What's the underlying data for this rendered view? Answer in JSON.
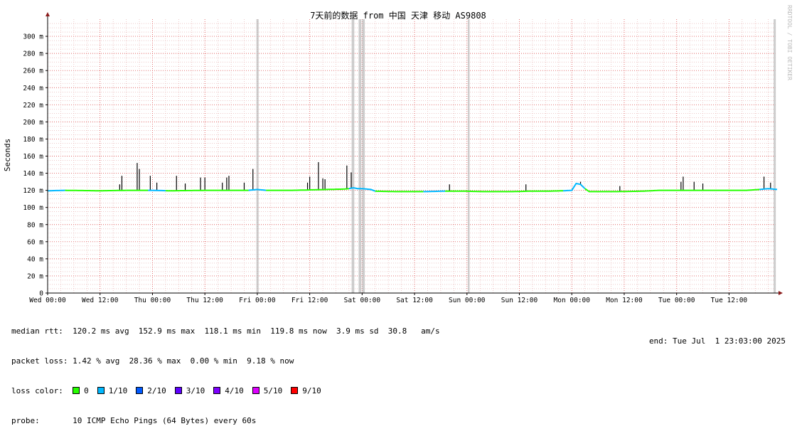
{
  "chart_data": {
    "type": "line",
    "title": "7天前的数据 from 中国 天津 移动 AS9808",
    "ylabel": "Seconds",
    "side_label": "RRDTOOL / TOBI OETIKER",
    "ylim": [
      0,
      320
    ],
    "y_ticks": [
      0,
      20,
      40,
      60,
      80,
      100,
      120,
      140,
      160,
      180,
      200,
      220,
      240,
      260,
      280,
      300
    ],
    "y_tick_labels": [
      "0",
      "20 m",
      "40 m",
      "60 m",
      "80 m",
      "100 m",
      "120 m",
      "140 m",
      "160 m",
      "180 m",
      "200 m",
      "220 m",
      "240 m",
      "260 m",
      "280 m",
      "300 m"
    ],
    "x_range_hours": [
      0,
      167
    ],
    "x_ticks": [
      {
        "label": "Wed 00:00",
        "hours": 0
      },
      {
        "label": "Wed 12:00",
        "hours": 12
      },
      {
        "label": "Thu 00:00",
        "hours": 24
      },
      {
        "label": "Thu 12:00",
        "hours": 36
      },
      {
        "label": "Fri 00:00",
        "hours": 48
      },
      {
        "label": "Fri 12:00",
        "hours": 60
      },
      {
        "label": "Sat 00:00",
        "hours": 72
      },
      {
        "label": "Sat 12:00",
        "hours": 84
      },
      {
        "label": "Sun 00:00",
        "hours": 96
      },
      {
        "label": "Sun 12:00",
        "hours": 108
      },
      {
        "label": "Mon 00:00",
        "hours": 120
      },
      {
        "label": "Mon 12:00",
        "hours": 132
      },
      {
        "label": "Tue 00:00",
        "hours": 144
      },
      {
        "label": "Tue 12:00",
        "hours": 156
      }
    ],
    "series": [
      {
        "name": "median rtt",
        "loss_segments": [
          {
            "x": [
              0,
              4
            ],
            "loss": 1
          },
          {
            "x": [
              4,
              18
            ],
            "loss": 0
          },
          {
            "x": [
              18,
              23
            ],
            "loss": 0
          },
          {
            "x": [
              23,
              27
            ],
            "loss": 1
          },
          {
            "x": [
              27,
              46
            ],
            "loss": 0
          },
          {
            "x": [
              46,
              50
            ],
            "loss": 1
          },
          {
            "x": [
              50,
              69
            ],
            "loss": 0
          },
          {
            "x": [
              69,
              75
            ],
            "loss": 1
          },
          {
            "x": [
              75,
              86
            ],
            "loss": 0
          },
          {
            "x": [
              86,
              91
            ],
            "loss": 1
          },
          {
            "x": [
              91,
              101
            ],
            "loss": 0
          },
          {
            "x": [
              101,
              118
            ],
            "loss": 0
          },
          {
            "x": [
              118,
              123
            ],
            "loss": 1
          },
          {
            "x": [
              123,
              163
            ],
            "loss": 0
          },
          {
            "x": [
              163,
              167
            ],
            "loss": 1
          }
        ],
        "points": [
          [
            0,
            119.5
          ],
          [
            4,
            120
          ],
          [
            12,
            119.5
          ],
          [
            18,
            120
          ],
          [
            22,
            120
          ],
          [
            24,
            120
          ],
          [
            28,
            119.5
          ],
          [
            36,
            120
          ],
          [
            46,
            120
          ],
          [
            48,
            121
          ],
          [
            50,
            120
          ],
          [
            56,
            120
          ],
          [
            60,
            120.5
          ],
          [
            64,
            121
          ],
          [
            68,
            121.5
          ],
          [
            69,
            122
          ],
          [
            70,
            123
          ],
          [
            71,
            122
          ],
          [
            72,
            122
          ],
          [
            74,
            121
          ],
          [
            75,
            119
          ],
          [
            80,
            118.5
          ],
          [
            86,
            118.5
          ],
          [
            90,
            119
          ],
          [
            96,
            119
          ],
          [
            100,
            118.5
          ],
          [
            106,
            118.5
          ],
          [
            110,
            119
          ],
          [
            114,
            119
          ],
          [
            118,
            119.5
          ],
          [
            120,
            120
          ],
          [
            121,
            128
          ],
          [
            122,
            127
          ],
          [
            123,
            122
          ],
          [
            124,
            118.5
          ],
          [
            130,
            118.5
          ],
          [
            136,
            119
          ],
          [
            140,
            120
          ],
          [
            146,
            120
          ],
          [
            152,
            120
          ],
          [
            158,
            120
          ],
          [
            160,
            120
          ],
          [
            163,
            121
          ],
          [
            165,
            122
          ],
          [
            167,
            121
          ]
        ]
      }
    ],
    "spikes_hours": [
      [
        16.5,
        127
      ],
      [
        17,
        137
      ],
      [
        20.5,
        152
      ],
      [
        21,
        145
      ],
      [
        23.5,
        137
      ],
      [
        25,
        129
      ],
      [
        29.5,
        137
      ],
      [
        31.5,
        128
      ],
      [
        35,
        135
      ],
      [
        36,
        135
      ],
      [
        40,
        129
      ],
      [
        41,
        135
      ],
      [
        41.5,
        137
      ],
      [
        45,
        129
      ],
      [
        47,
        145
      ],
      [
        59.5,
        129
      ],
      [
        60,
        136
      ],
      [
        62,
        153
      ],
      [
        63,
        134
      ],
      [
        63.5,
        133
      ],
      [
        68.5,
        149
      ],
      [
        69.5,
        141
      ],
      [
        92,
        127
      ],
      [
        109.5,
        127
      ],
      [
        122,
        130
      ],
      [
        131,
        125
      ],
      [
        145,
        130
      ],
      [
        145.5,
        136
      ],
      [
        148,
        130
      ],
      [
        150,
        128
      ],
      [
        164,
        136
      ],
      [
        165.5,
        129
      ]
    ],
    "loss_bars_hours": [
      [
        47.8,
        48.3
      ],
      [
        69.6,
        70.2
      ],
      [
        71.2,
        71.8
      ],
      [
        72.0,
        72.6
      ],
      [
        96.2,
        96.6
      ],
      [
        166.2,
        166.7
      ]
    ],
    "loss_colors": {
      "0": "#26ff00",
      "1/10": "#00b8ff",
      "2/10": "#0059ff",
      "3/10": "#5e00ff",
      "4/10": "#7e00ff",
      "5/10": "#dd00ff",
      "9/10": "#ff0000"
    },
    "colors": {
      "spike": "#000000",
      "loss_bar": "#c0c0c0",
      "minor_grid": "#e3a7a7",
      "major_grid": "#e06060",
      "axis": "#000000",
      "arrow": "#8b1a1a"
    }
  },
  "legend": {
    "median_rtt": "median rtt:  120.2 ms avg  152.9 ms max  118.1 ms min  119.8 ms now  3.9 ms sd  30.8   am/s",
    "packet_loss": "packet loss: 1.42 % avg  28.36 % max  0.00 % min  9.18 % now",
    "loss_color_label": "loss color:",
    "loss_color_items": [
      {
        "label": "0",
        "color": "#26ff00"
      },
      {
        "label": "1/10",
        "color": "#00b8ff"
      },
      {
        "label": "2/10",
        "color": "#0059ff"
      },
      {
        "label": "3/10",
        "color": "#5e00ff"
      },
      {
        "label": "4/10",
        "color": "#7e00ff"
      },
      {
        "label": "5/10",
        "color": "#dd00ff"
      },
      {
        "label": "9/10",
        "color": "#ff0000"
      }
    ],
    "probe_label": "probe:",
    "probe_value": "10 ICMP Echo Pings (64 Bytes) every 60s",
    "end_text": "end: Tue Jul  1 23:03:00 2025"
  }
}
